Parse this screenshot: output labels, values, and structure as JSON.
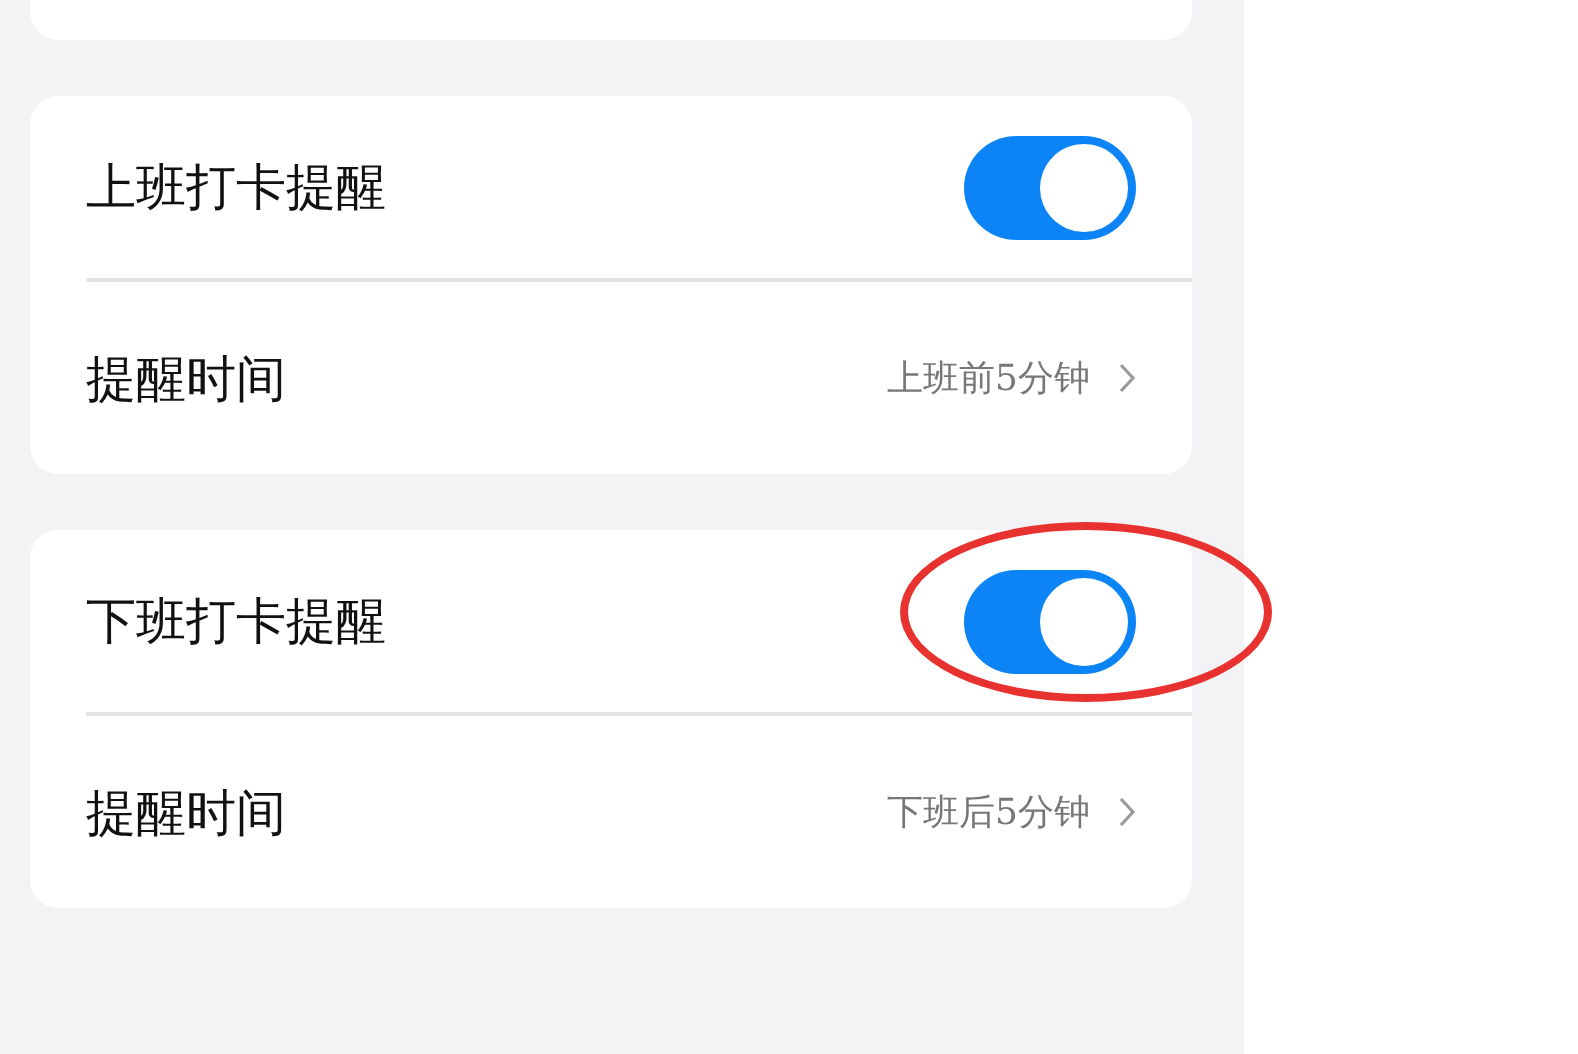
{
  "sections": [
    {
      "label": "上班打卡提醒",
      "on": true,
      "circled": false,
      "rows": [
        {
          "label": "提醒时间",
          "value": "上班前5分钟"
        }
      ]
    },
    {
      "label": "下班打卡提醒",
      "on": true,
      "circled": true,
      "rows": [
        {
          "label": "提醒时间",
          "value": "下班后5分钟"
        }
      ]
    }
  ]
}
